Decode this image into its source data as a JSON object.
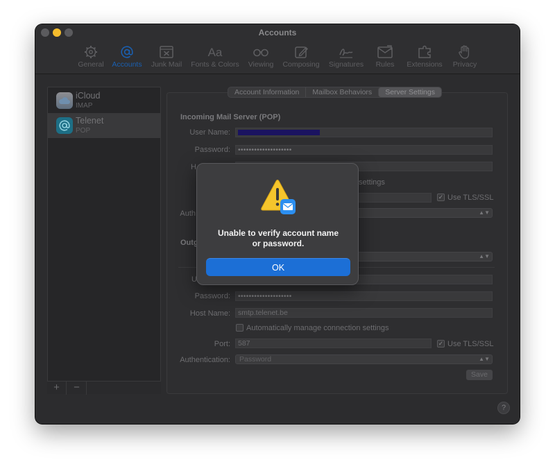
{
  "window": {
    "title": "Accounts"
  },
  "toolbar": {
    "items": [
      {
        "label": "General",
        "icon": "gear-icon"
      },
      {
        "label": "Accounts",
        "icon": "at-icon"
      },
      {
        "label": "Junk Mail",
        "icon": "junk-icon"
      },
      {
        "label": "Fonts & Colors",
        "icon": "fonts-icon"
      },
      {
        "label": "Viewing",
        "icon": "glasses-icon"
      },
      {
        "label": "Composing",
        "icon": "compose-icon"
      },
      {
        "label": "Signatures",
        "icon": "signature-icon"
      },
      {
        "label": "Rules",
        "icon": "rules-icon"
      },
      {
        "label": "Extensions",
        "icon": "extensions-icon"
      },
      {
        "label": "Privacy",
        "icon": "hand-icon"
      }
    ],
    "active": "Accounts"
  },
  "sidebar": {
    "accounts": [
      {
        "name": "iCloud",
        "type": "IMAP",
        "icon": "cloud-icon"
      },
      {
        "name": "Telenet",
        "type": "POP",
        "icon": "at-icon"
      }
    ],
    "add_label": "+",
    "remove_label": "−"
  },
  "tabs": {
    "items": [
      "Account Information",
      "Mailbox Behaviors",
      "Server Settings"
    ],
    "active": "Server Settings"
  },
  "incoming": {
    "title": "Incoming Mail Server (POP)",
    "user_name_label": "User Name:",
    "password_label": "Password:",
    "password_value": "••••••••••••••••••••",
    "host_label_partial": "H",
    "auto_manage_partial": "settings",
    "tls_label": "Use TLS/SSL",
    "auth_label_partial": "Auth"
  },
  "outgoing": {
    "title_partial": "Outg",
    "user_label_partial": "U",
    "password_label": "Password:",
    "password_value": "••••••••••••••••••••",
    "host_label": "Host Name:",
    "host_value": "smtp.telenet.be",
    "auto_manage_label": "Automatically manage connection settings",
    "port_label": "Port:",
    "port_value": "587",
    "tls_label": "Use TLS/SSL",
    "auth_label": "Authentication:",
    "auth_value": "Password"
  },
  "save_label": "Save",
  "help_label": "?",
  "dialog": {
    "message_line1": "Unable to verify account name",
    "message_line2": "or password.",
    "ok_label": "OK",
    "icon": "warning-mail-icon"
  }
}
